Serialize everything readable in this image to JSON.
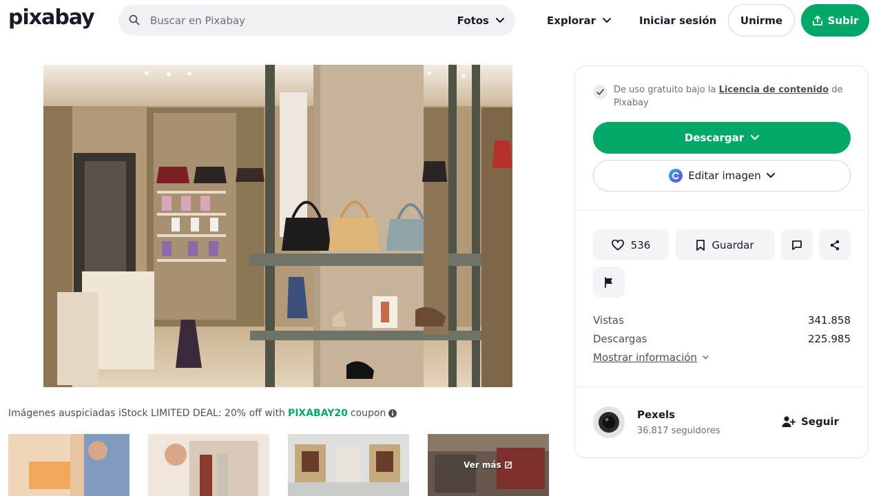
{
  "header": {
    "logo": "pixabay",
    "search_placeholder": "Buscar en Pixabay",
    "search_type": "Fotos",
    "explore_label": "Explorar",
    "login_label": "Iniciar sesión",
    "join_label": "Unirme",
    "upload_label": "Subir"
  },
  "panel": {
    "license_prefix": "De uso gratuito bajo la ",
    "license_link": "Licencia de contenido",
    "license_suffix": " de Pixabay",
    "download_label": "Descargar",
    "edit_label": "Editar imagen",
    "likes": "536",
    "save_label": "Guardar",
    "stats": [
      {
        "label": "Vistas",
        "value": "341.858"
      },
      {
        "label": "Descargas",
        "value": "225.985"
      }
    ],
    "more_info_label": "Mostrar información",
    "user": {
      "name": "Pexels",
      "followers": "36.817 seguidores",
      "follow_label": "Seguir"
    }
  },
  "sponsored": {
    "text": "Imágenes auspiciadas iStock LIMITED DEAL: 20% off with ",
    "code": "PIXABAY20",
    "suffix": " coupon",
    "see_more": "Ver más"
  },
  "icons": {
    "search": "search-icon",
    "chevron": "chevron-down-icon",
    "upload": "upload-icon",
    "check": "check-icon",
    "heart": "heart-icon",
    "bookmark": "bookmark-icon",
    "comment": "comment-icon",
    "share": "share-icon",
    "flag": "flag-icon",
    "follow": "add-user-icon"
  },
  "colors": {
    "accent": "#00a867",
    "text": "#191b26",
    "muted": "#6c6e79"
  }
}
